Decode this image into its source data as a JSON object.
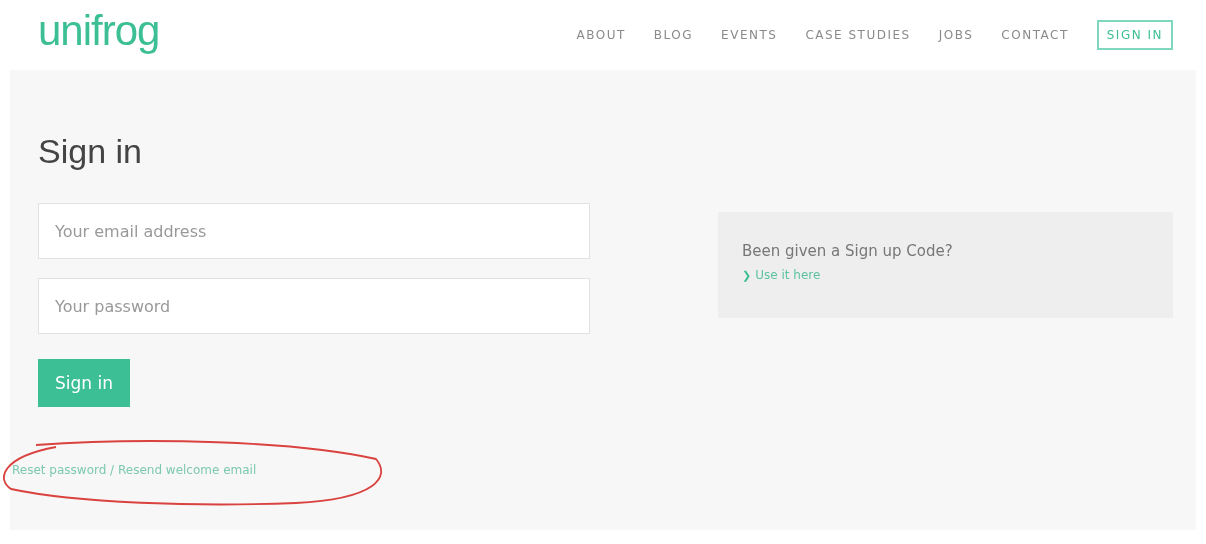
{
  "header": {
    "logo": "unifrog",
    "nav": [
      {
        "label": "ABOUT",
        "kind": "link"
      },
      {
        "label": "BLOG",
        "kind": "link"
      },
      {
        "label": "EVENTS",
        "kind": "link"
      },
      {
        "label": "CASE STUDIES",
        "kind": "link"
      },
      {
        "label": "JOBS",
        "kind": "link"
      },
      {
        "label": "CONTACT",
        "kind": "link"
      },
      {
        "label": "SIGN IN",
        "kind": "button"
      }
    ]
  },
  "form": {
    "title": "Sign in",
    "email": {
      "placeholder": "Your email address"
    },
    "password": {
      "placeholder": "Your password"
    },
    "submit": "Sign in",
    "reset_link": "Reset password / Resend welcome email"
  },
  "signup_panel": {
    "question": "Been given a Sign up Code?",
    "chevron": "❯",
    "link": "Use it here"
  }
}
